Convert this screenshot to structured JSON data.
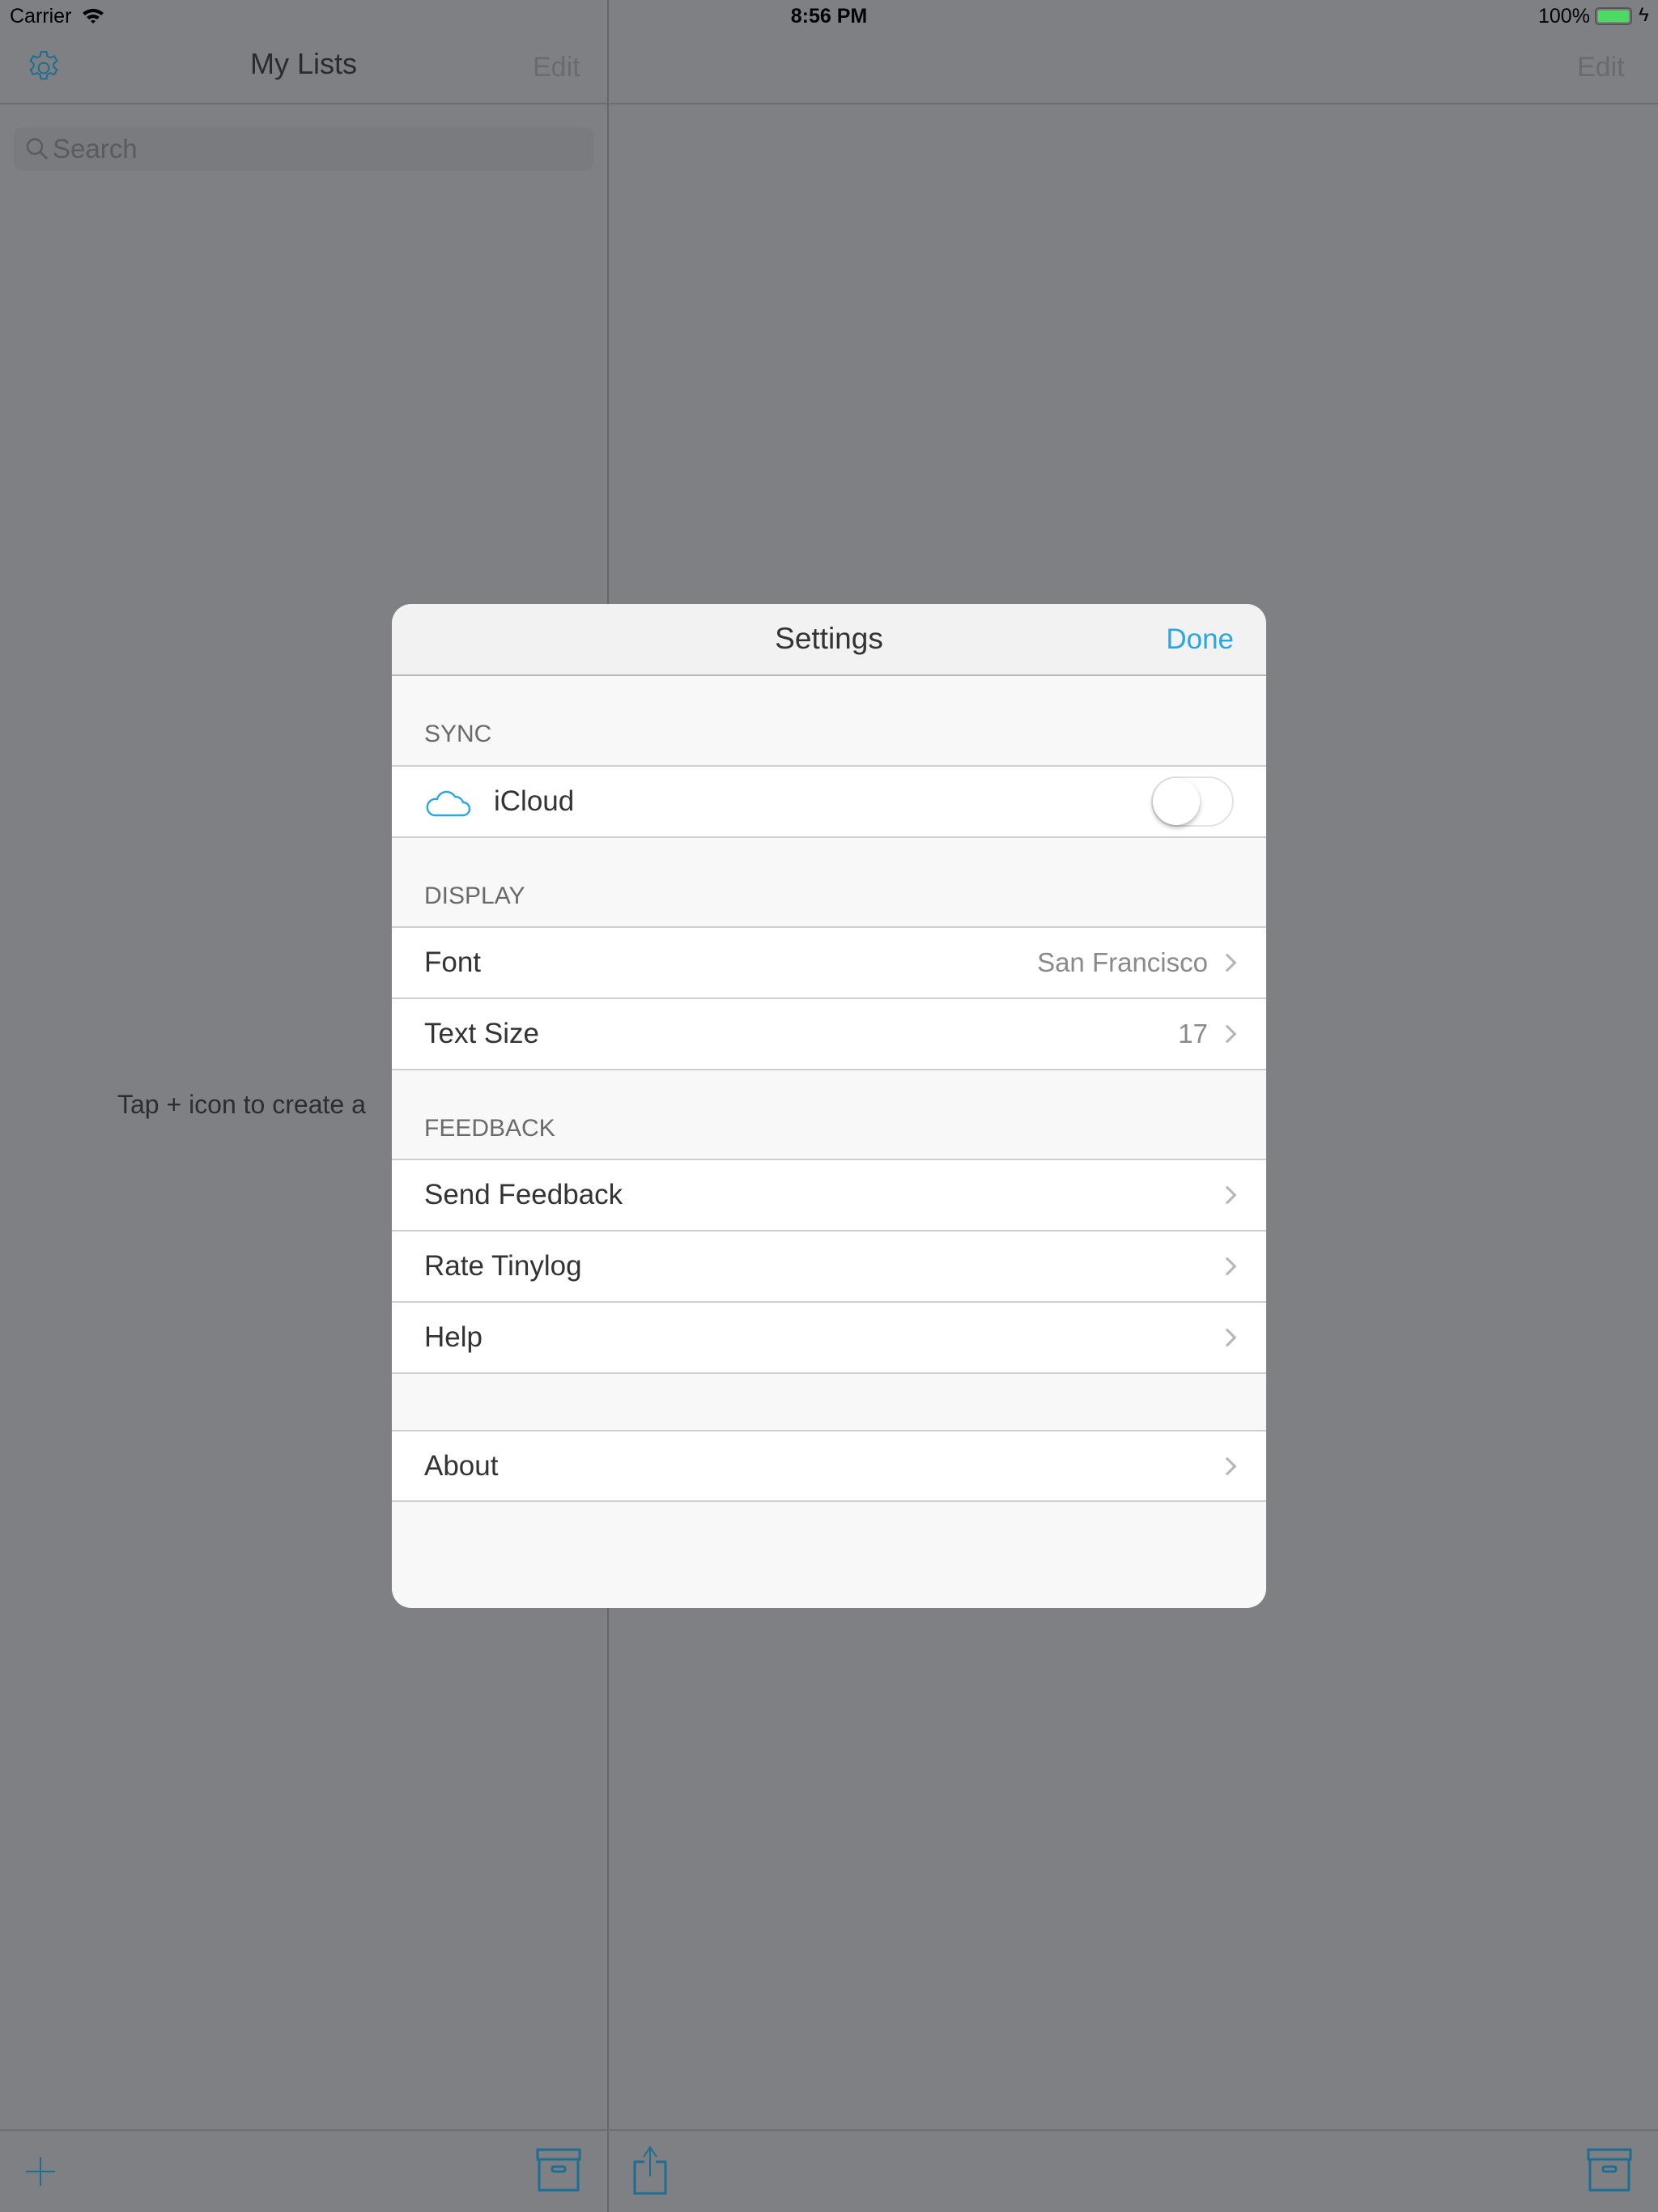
{
  "status_bar": {
    "carrier": "Carrier",
    "time": "8:56 PM",
    "battery": "100%",
    "battery_level": 1.0,
    "battery_color": "#4cd964"
  },
  "sidebar": {
    "title": "My Lists",
    "edit": "Edit",
    "search_placeholder": "Search",
    "empty_text": "Tap + icon to create a"
  },
  "detail": {
    "edit": "Edit"
  },
  "accent": "#1c6e93",
  "settings": {
    "title": "Settings",
    "done": "Done",
    "done_color": "#2aa6e0",
    "sync": {
      "header": "SYNC",
      "icloud": "iCloud",
      "icloud_enabled": false
    },
    "display": {
      "header": "DISPLAY",
      "font_label": "Font",
      "font_value": "San Francisco",
      "size_label": "Text Size",
      "size_value": "17"
    },
    "feedback": {
      "header": "FEEDBACK",
      "items": [
        "Send Feedback",
        "Rate Tinylog",
        "Help"
      ]
    },
    "about": "About"
  }
}
